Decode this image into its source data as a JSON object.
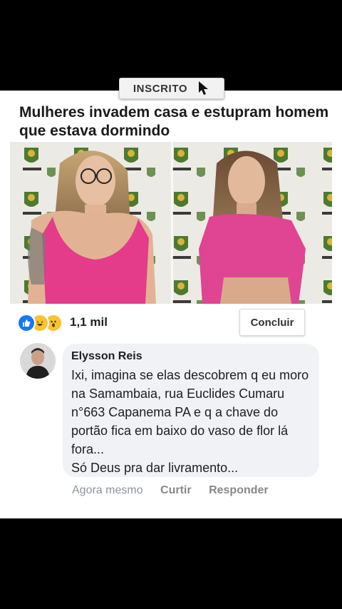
{
  "subscribe": {
    "label": "INSCRITO",
    "icon": "cursor-icon"
  },
  "post": {
    "headline": "Mulheres invadem casa e estupram homem que estava dormindo"
  },
  "reactions": {
    "icons": [
      "like-icon",
      "haha-icon",
      "wow-icon"
    ],
    "count": "1,1 mil"
  },
  "finish_button": "Concluir",
  "comment": {
    "author": "Elysson Reis",
    "text": "Ixi, imagina se elas descobrem q eu moro na Samambaia, rua Euclides Cumaru n°663  Capanema PA e q a chave do portão fica em baixo do vaso de flor lá fora...\nSó Deus pra dar livramento...",
    "time": "Agora mesmo",
    "like_label": "Curtir",
    "reply_label": "Responder"
  },
  "colors": {
    "like_blue": "#1877f2",
    "bubble": "#f1f2f6",
    "top_pink": "#e43b8a"
  }
}
